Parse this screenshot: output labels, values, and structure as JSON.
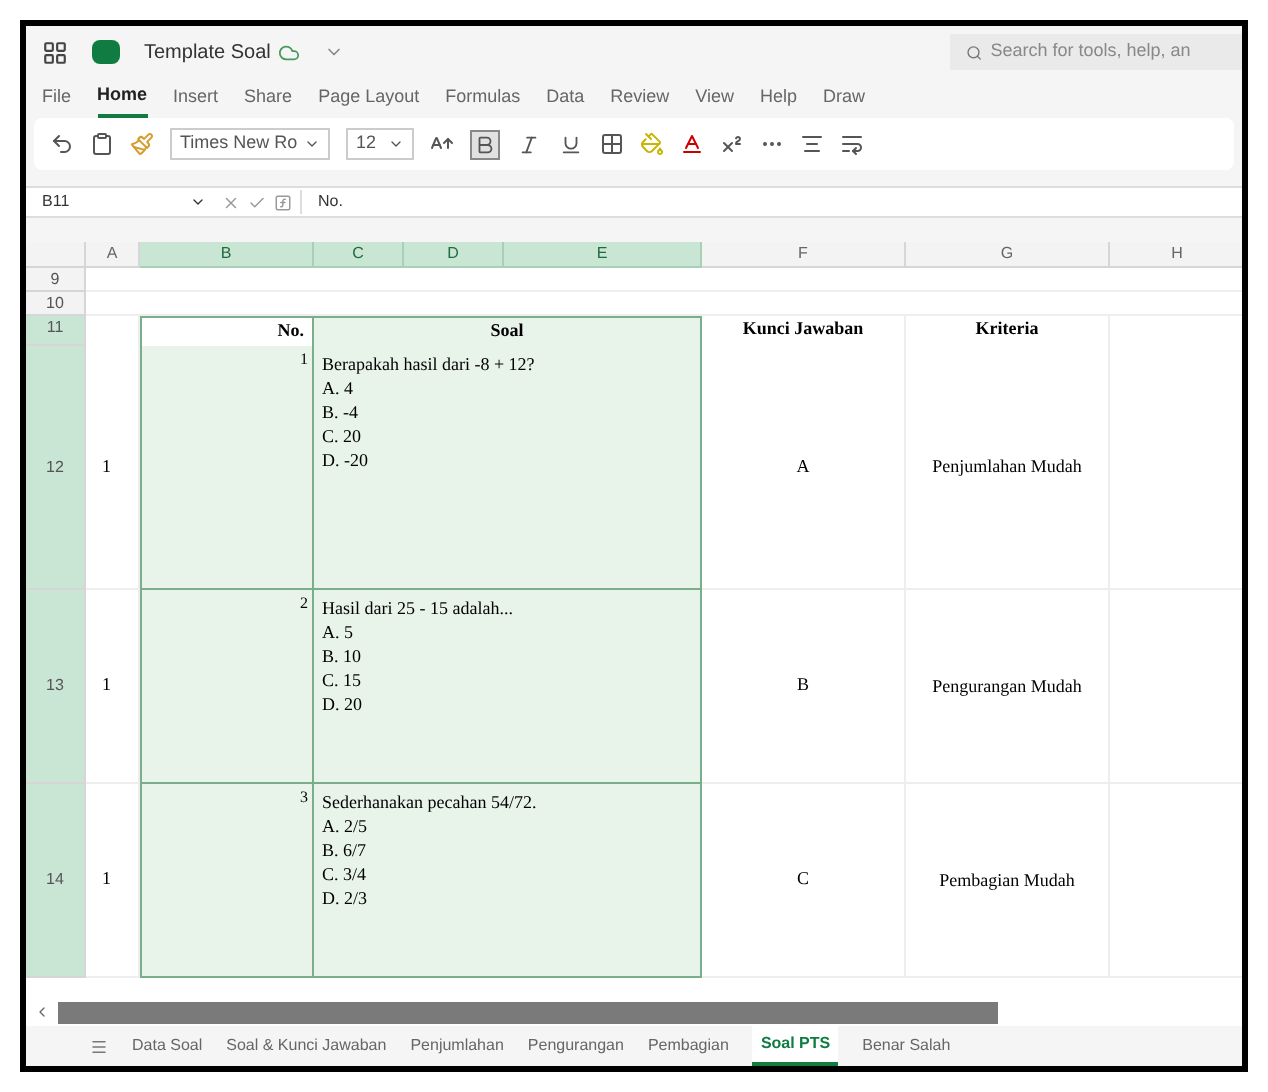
{
  "title_bar": {
    "doc_title": "Template Soal",
    "search": {
      "placeholder": "Search for tools, help, an"
    }
  },
  "menu_tabs": [
    {
      "label": "File",
      "selected": false
    },
    {
      "label": "Home",
      "selected": true
    },
    {
      "label": "Insert",
      "selected": false
    },
    {
      "label": "Share",
      "selected": false
    },
    {
      "label": "Page Layout",
      "selected": false
    },
    {
      "label": "Formulas",
      "selected": false
    },
    {
      "label": "Data",
      "selected": false
    },
    {
      "label": "Review",
      "selected": false
    },
    {
      "label": "View",
      "selected": false
    },
    {
      "label": "Help",
      "selected": false
    },
    {
      "label": "Draw",
      "selected": false
    }
  ],
  "toolbar": {
    "font_name": "Times New Ro",
    "font_size": "12",
    "bold": true,
    "italic": false,
    "underline": false
  },
  "formula_bar": {
    "name_box": "B11",
    "content": "No."
  },
  "columns": [
    {
      "label": "A",
      "selected": false
    },
    {
      "label": "B",
      "selected": true
    },
    {
      "label": "C",
      "selected": true
    },
    {
      "label": "D",
      "selected": true
    },
    {
      "label": "E",
      "selected": true
    },
    {
      "label": "F",
      "selected": false
    },
    {
      "label": "G",
      "selected": false
    },
    {
      "label": "H",
      "selected": false
    }
  ],
  "empty_rows": [
    {
      "label": "9"
    },
    {
      "label": "10"
    }
  ],
  "header_row": {
    "label": "11",
    "no": "No.",
    "soal": "Soal",
    "kunci": "Kunci Jawaban",
    "kriteria": "Kriteria"
  },
  "rows": [
    {
      "label": "12",
      "col_a": "1",
      "number": "1",
      "question": "Berapakah hasil dari -8 + 12?",
      "options": [
        "A. 4",
        "B. -4",
        "C. 20",
        "D. -20"
      ],
      "key": "A",
      "criteria": "Penjumlahan Mudah"
    },
    {
      "label": "13",
      "col_a": "1",
      "number": "2",
      "question": "Hasil dari 25 - 15 adalah...",
      "options": [
        "A. 5",
        "B. 10",
        "C. 15",
        "D. 20"
      ],
      "key": "B",
      "criteria": "Pengurangan Mudah"
    },
    {
      "label": "14",
      "col_a": "1",
      "number": "3",
      "question": "Sederhanakan pecahan 54/72.",
      "options": [
        "A. 2/5",
        "B. 6/7",
        "C. 3/4",
        "D. 2/3"
      ],
      "key": "C",
      "criteria": "Pembagian Mudah"
    }
  ],
  "sheet_tabs": [
    {
      "label": "Data Soal",
      "selected": false
    },
    {
      "label": "Soal & Kunci Jawaban",
      "selected": false
    },
    {
      "label": "Penjumlahan",
      "selected": false
    },
    {
      "label": "Pengurangan",
      "selected": false
    },
    {
      "label": "Pembagian",
      "selected": false
    },
    {
      "label": "Soal PTS",
      "selected": true
    },
    {
      "label": "Benar Salah",
      "selected": false
    }
  ]
}
